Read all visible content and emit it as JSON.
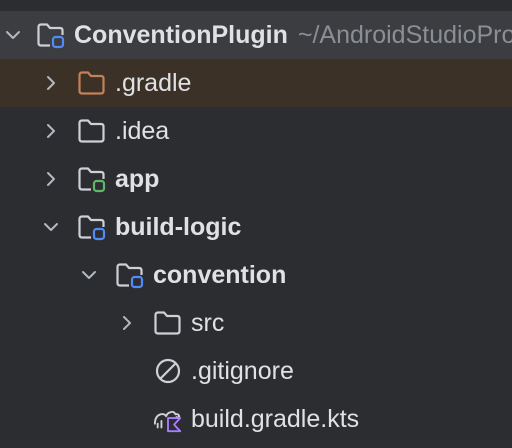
{
  "project": {
    "name": "ConventionPlugin",
    "path": "~/AndroidStudioProjects/ConventionPlugin"
  },
  "items": [
    {
      "label": ".gradle",
      "icon": "folder-icon",
      "expanded": false,
      "color": "#c4815a"
    },
    {
      "label": ".idea",
      "icon": "folder-icon",
      "expanded": false
    },
    {
      "label": "app",
      "icon": "module-folder-icon",
      "expanded": false,
      "badge_color": "#5fb865"
    },
    {
      "label": "build-logic",
      "icon": "module-folder-icon",
      "expanded": true,
      "badge_color": "#548af7"
    },
    {
      "label": "convention",
      "icon": "module-folder-icon",
      "expanded": true,
      "badge_color": "#548af7"
    },
    {
      "label": "src",
      "icon": "folder-icon",
      "expanded": false
    },
    {
      "label": ".gitignore",
      "icon": "ignored-file-icon"
    },
    {
      "label": "build.gradle.kts",
      "icon": "gradle-kotlin-icon"
    }
  ],
  "colors": {
    "background": "#2b2d30",
    "root_row": "#3b3d41",
    "highlight_row": "#3b3127",
    "text": "#dfe1e5",
    "muted_text": "#8b8e94",
    "kotlin_accent": "#a97bff"
  }
}
